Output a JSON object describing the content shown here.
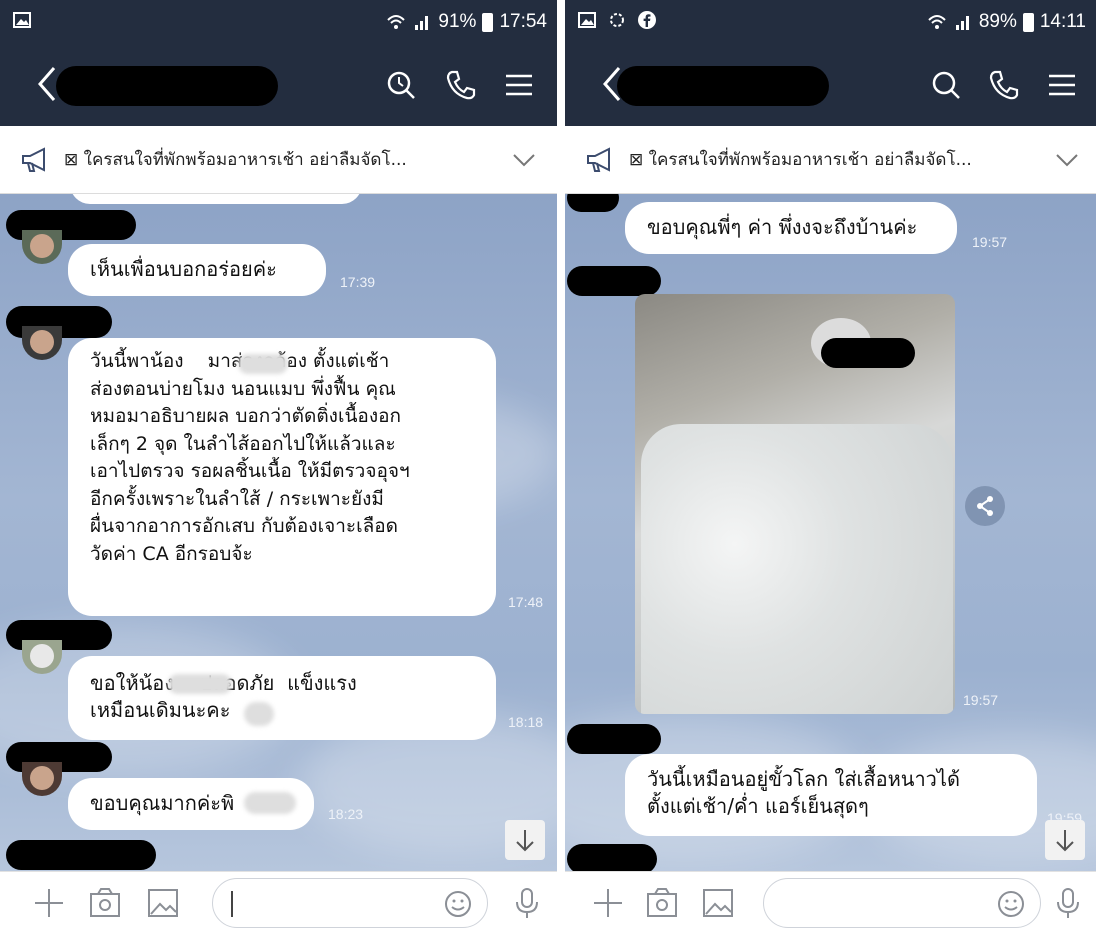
{
  "left_phone": {
    "status": {
      "battery": "91%",
      "time": "17:54"
    },
    "notice": "⊠ ใครสนใจที่พักพร้อมอาหารเช้า อย่าลืมจัดโ...",
    "messages": [
      {
        "text": "เห็นเพื่อนบอกอร่อยค่ะ",
        "time": "17:39"
      },
      {
        "text": "วันนี้พาน้อง    มาส่องกล้อง ตั้งแต่เช้า\nส่องตอนบ่ายโมง นอนแมบ พึ่งฟื้น คุณ\nหมอมาอธิบายผล บอกว่าตัดติ่งเนื้องอก\nเล็กๆ 2 จุด ในลำไส้ออกไปให้แล้วและ\nเอาไปตรวจ รอผลชิ้นเนื้อ ให้มีตรวจอุจฯ\nอีกครั้งเพราะในลำใส้ / กระเพาะยังมี\nผื่นจากอาการอักเสบ กับต้องเจาะเลือด\nวัดค่า CA อีกรอบจ้ะ",
        "time": "17:48"
      },
      {
        "text": "ขอให้น้อง    ปลอดภัย  แข็งแรง\nเหมือนเดิมนะคะ",
        "time": "18:18"
      },
      {
        "text": "ขอบคุณมากค่ะพิ",
        "time": "18:23"
      }
    ]
  },
  "right_phone": {
    "status": {
      "battery": "89%",
      "time": "14:11"
    },
    "notice": "⊠ ใครสนใจที่พักพร้อมอาหารเช้า อย่าลืมจัดโ...",
    "messages": [
      {
        "text": "ขอบคุณพี่ๆ ค่า พึ่งงจะถึงบ้านค่ะ",
        "time": "19:57"
      },
      {
        "text": "",
        "time": "19:57"
      },
      {
        "text": "วันนี้เหมือนอยู่ขั้วโลก ใส่เสื้อหนาวได้\nตั้งแต่เช้า/ค่ำ แอร์เย็นสุดๆ",
        "time": "19:59"
      }
    ]
  },
  "colors": {
    "header": "#232d3f",
    "chat_bg": "#9cb1d0",
    "bubble": "#ffffff"
  },
  "icons": [
    "back-icon",
    "search-icon",
    "phone-icon",
    "menu-icon",
    "megaphone-icon",
    "chevron-down-icon",
    "plus-icon",
    "camera-icon",
    "image-icon",
    "emoji-icon",
    "mic-icon",
    "arrow-down-icon",
    "share-icon"
  ]
}
